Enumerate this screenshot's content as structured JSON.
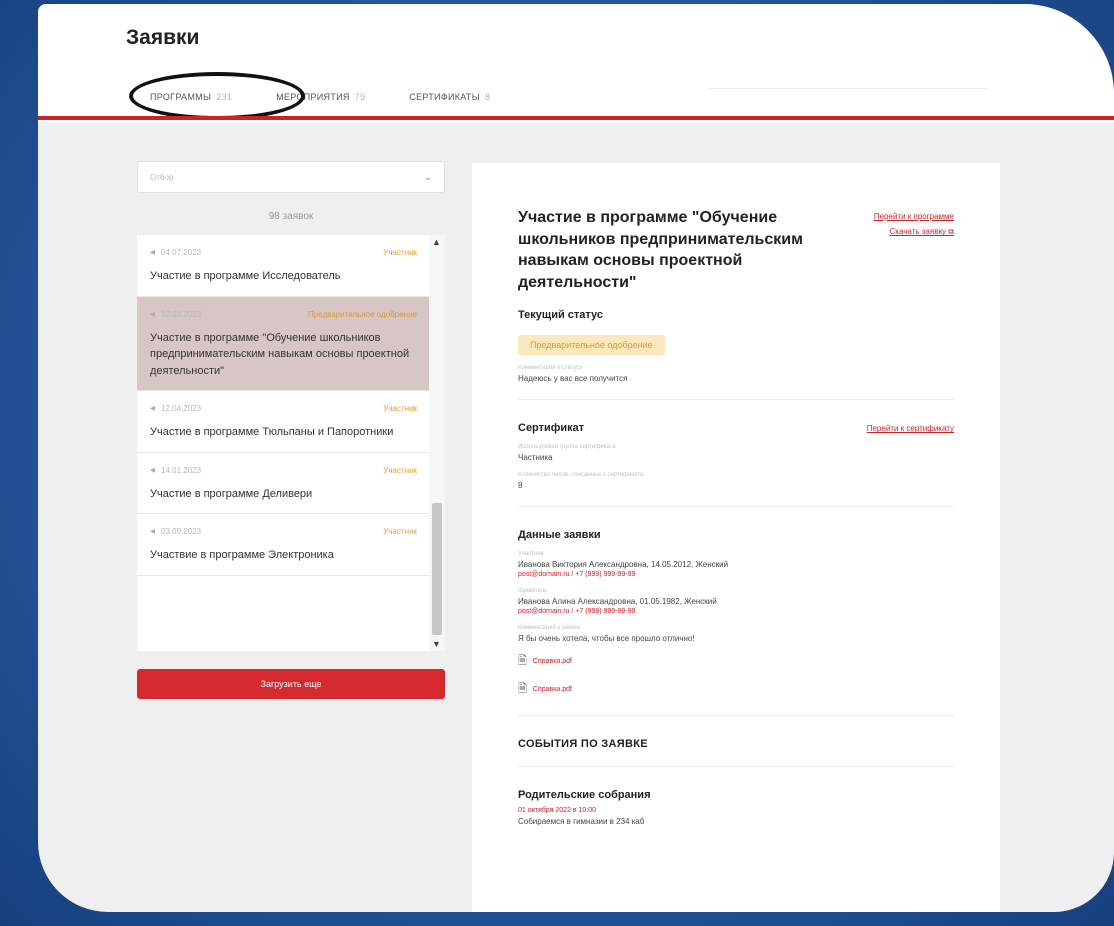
{
  "page": {
    "title": "Заявки"
  },
  "tabs": [
    {
      "label": "ПРОГРАММЫ",
      "count": "231"
    },
    {
      "label": "МЕРОПРИЯТИЯ",
      "count": "79"
    },
    {
      "label": "СЕРТИФИКАТЫ",
      "count": "8"
    }
  ],
  "filter": {
    "placeholder": "Отбор"
  },
  "requests_count": "98 заявок",
  "list": [
    {
      "date": "04.07.2023",
      "status": "Участник",
      "title": "Участие в программе Исследователь"
    },
    {
      "date": "12.03.2023",
      "status": "Предварительное одобрение",
      "title": "Участие в программе \"Обучение школьников предпринимательским навыкам основы проектной деятельности\""
    },
    {
      "date": "12.04.2023",
      "status": "Участник",
      "title": "Участие в программе Тюльпаны и Папоротники"
    },
    {
      "date": "14.01.2023",
      "status": "Участник",
      "title": "Участие в программе Деливери"
    },
    {
      "date": "03.09.2023",
      "status": "Участник",
      "title": "Участвие в программе Электроника"
    }
  ],
  "load_more": "Загрузить еще",
  "detail": {
    "title": "Участие в программе \"Обучение школьников предпринимательским навыкам основы проектной деятельности\"",
    "link_program": "Перейти к программе",
    "link_download": "Скачать заявку",
    "status_heading": "Текущий статус",
    "status_badge": "Предварительное одобрение",
    "comment_label": "Комментарий к статусу",
    "comment_value": "Надеюсь у вас все получится",
    "cert_heading": "Сертификат",
    "cert_link": "Перейти к сертификату",
    "cert_role_label": "Используемая группа сертификата",
    "cert_role_value": "Частника",
    "cert_hours_label": "Количество часов, списанных с сертификата",
    "cert_hours_value": "8",
    "data_heading": "Данные заявки",
    "participant_label": "Участник",
    "participant_value": "Иванова Виктория Александровна, 14.05.2012, Женский",
    "participant_contact": "post@domain.ru / +7 (999) 999-99-99",
    "parent_label": "Заявитель",
    "parent_value": "Иванова Алина Александровна, 01.05.1982, Женский",
    "parent_contact": "post@domain.ru / +7 (999) 999-99-99",
    "note_label": "Комментарий к заявке",
    "note_value": "Я бы очень хотела, чтобы все прошло отлично!",
    "file1": "Справка.pdf",
    "file2": "Справка.pdf",
    "events_heading": "СОБЫТИЯ ПО ЗАЯВКЕ",
    "event_title": "Родительские собрания",
    "event_date": "01 октября 2022 в 10:00",
    "event_desc": "Собираемся в гимназии в 234 каб"
  }
}
